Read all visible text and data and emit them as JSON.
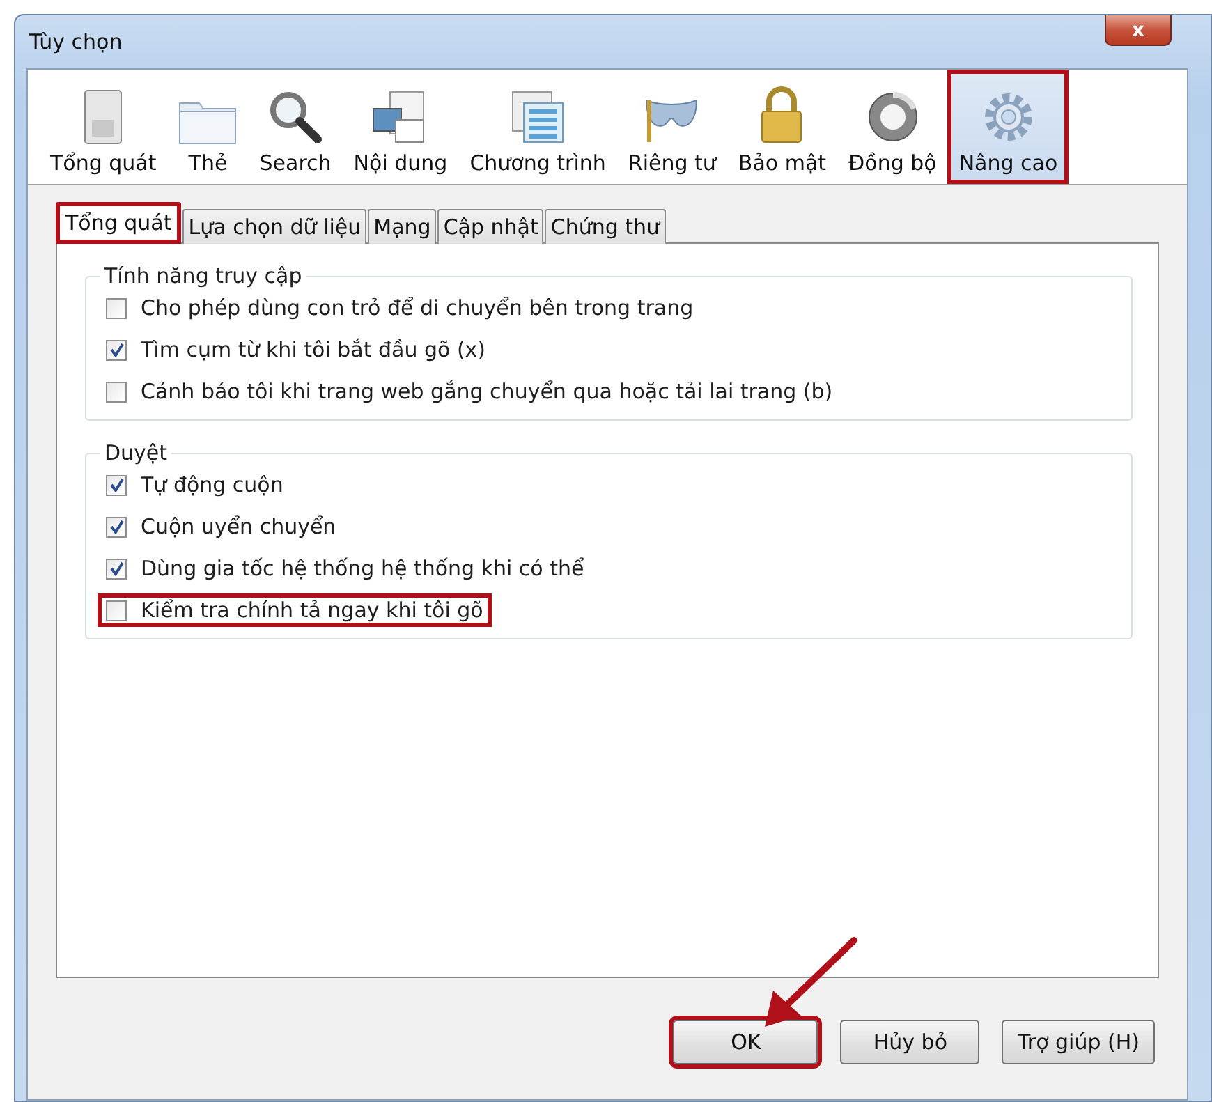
{
  "window": {
    "title": "Tùy chọn",
    "close": "x"
  },
  "toolbar": [
    {
      "label": "Tổng quát",
      "selected": false,
      "highlighted": false
    },
    {
      "label": "Thẻ",
      "selected": false,
      "highlighted": false
    },
    {
      "label": "Search",
      "selected": false,
      "highlighted": false
    },
    {
      "label": "Nội dung",
      "selected": false,
      "highlighted": false
    },
    {
      "label": "Chương trình",
      "selected": false,
      "highlighted": false
    },
    {
      "label": "Riêng tư",
      "selected": false,
      "highlighted": false
    },
    {
      "label": "Bảo mật",
      "selected": false,
      "highlighted": false
    },
    {
      "label": "Đồng bộ",
      "selected": false,
      "highlighted": false
    },
    {
      "label": "Nâng cao",
      "selected": true,
      "highlighted": true
    }
  ],
  "tabs": [
    {
      "label": "Tổng quát",
      "selected": true,
      "highlighted": true
    },
    {
      "label": "Lựa chọn dữ liệu",
      "selected": false,
      "highlighted": false
    },
    {
      "label": "Mạng",
      "selected": false,
      "highlighted": false
    },
    {
      "label": "Cập nhật",
      "selected": false,
      "highlighted": false
    },
    {
      "label": "Chứng thư",
      "selected": false,
      "highlighted": false
    }
  ],
  "groups": [
    {
      "title": "Tính năng truy cập",
      "options": [
        {
          "label": "Cho phép dùng con trỏ để di chuyển bên trong trang",
          "checked": false,
          "highlighted": false
        },
        {
          "label": "Tìm cụm từ khi tôi bắt đầu gõ (x)",
          "checked": true,
          "highlighted": false
        },
        {
          "label": "Cảnh báo tôi khi trang web gắng chuyển qua hoặc tải lai trang (b)",
          "checked": false,
          "highlighted": false
        }
      ]
    },
    {
      "title": "Duyệt",
      "options": [
        {
          "label": "Tự động cuộn",
          "checked": true,
          "highlighted": false
        },
        {
          "label": "Cuộn uyển chuyển",
          "checked": true,
          "highlighted": false
        },
        {
          "label": "Dùng gia tốc hệ thống hệ thống khi có thể",
          "checked": true,
          "highlighted": false
        },
        {
          "label": "Kiểm tra chính tả ngay khi tôi gõ",
          "checked": false,
          "highlighted": true
        }
      ]
    }
  ],
  "buttons": [
    {
      "label": "OK",
      "highlighted": true
    },
    {
      "label": "Hủy bỏ",
      "highlighted": false
    },
    {
      "label": "Trợ giúp (H)",
      "highlighted": false
    }
  ]
}
